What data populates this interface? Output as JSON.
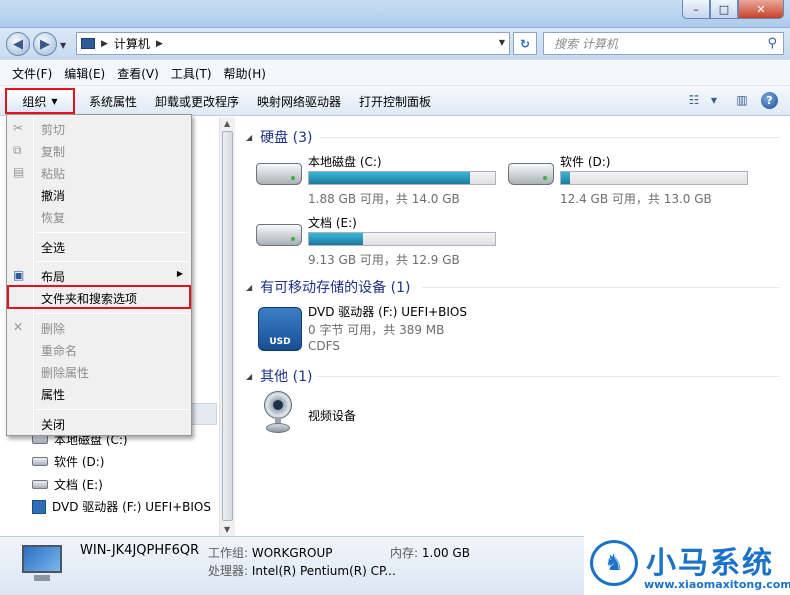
{
  "window": {
    "minimize": "–",
    "maximize": "□",
    "close": "✕"
  },
  "address": {
    "crumb": "计算机",
    "search_placeholder": "搜索 计算机"
  },
  "menubar": [
    "文件(F)",
    "编辑(E)",
    "查看(V)",
    "工具(T)",
    "帮助(H)"
  ],
  "cmdbar": {
    "organize": "组织",
    "commands": [
      "系统属性",
      "卸载或更改程序",
      "映射网络驱动器",
      "打开控制面板"
    ]
  },
  "context_menu": {
    "cut": "剪切",
    "copy": "复制",
    "paste": "粘贴",
    "undo": "撤消",
    "redo": "恢复",
    "select_all": "全选",
    "layout": "布局",
    "folder_options": "文件夹和搜索选项",
    "delete": "删除",
    "rename": "重命名",
    "remove_props": "删除属性",
    "properties": "属性",
    "close": "关闭"
  },
  "tree": [
    "本地磁盘 (C:)",
    "软件 (D:)",
    "文档 (E:)",
    "DVD 驱动器 (F:) UEFI+BIOS"
  ],
  "groups": {
    "hdd": "硬盘 (3)",
    "removable": "有可移动存储的设备 (1)",
    "other": "其他 (1)"
  },
  "drives": [
    {
      "name": "本地磁盘 (C:)",
      "cap": "1.88 GB 可用，共 14.0 GB",
      "used_fraction": 0.866
    },
    {
      "name": "软件 (D:)",
      "cap": "12.4 GB 可用，共 13.0 GB",
      "used_fraction": 0.046
    },
    {
      "name": "文档 (E:)",
      "cap": "9.13 GB 可用，共 12.9 GB",
      "used_fraction": 0.292
    }
  ],
  "dvd": {
    "name": "DVD 驱动器 (F:) UEFI+BIOS",
    "line1": "0 字节 可用，共 389 MB",
    "line2": "CDFS",
    "icon_text": "USD"
  },
  "other_device": "视频设备",
  "details": {
    "computer_name": "WIN-JK4JQPHF6QR",
    "workgroup_label": "工作组:",
    "workgroup": "WORKGROUP",
    "memory_label": "内存:",
    "memory": "1.00 GB",
    "cpu_label": "处理器:",
    "cpu": "Intel(R) Pentium(R) CP..."
  },
  "logo": {
    "brand": "小马系统",
    "url": "www.xiaomaxitong.com"
  }
}
